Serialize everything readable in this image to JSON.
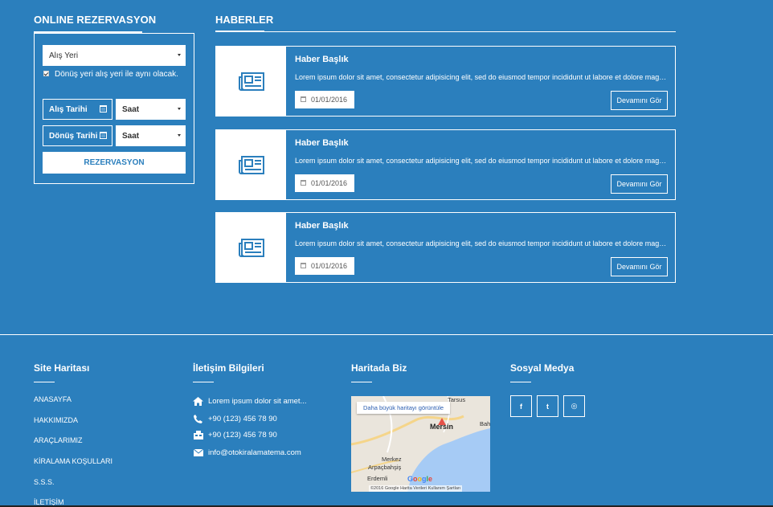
{
  "reservation": {
    "title": "ONLINE REZERVASYON",
    "pickup_placeholder": "Alış Yeri",
    "return_same_label": "Dönüş yeri alış yeri ile aynı olacak.",
    "return_same_checked": true,
    "pickup_date_label": "Alış Tarihi",
    "return_date_label": "Dönüş Tarihi",
    "pickup_time_label": "Saat",
    "return_time_label": "Saat",
    "submit_label": "REZERVASYON"
  },
  "news": {
    "title": "HABERLER",
    "items": [
      {
        "headline": "Haber Başlık",
        "text": "Lorem ipsum dolor sit amet, consectetur adipisicing elit, sed do eiusmod tempor incididunt ut labore et dolore magna aliqua.",
        "date": "01/01/2016",
        "more_label": "Devamını Gör"
      },
      {
        "headline": "Haber Başlık",
        "text": "Lorem ipsum dolor sit amet, consectetur adipisicing elit, sed do eiusmod tempor incididunt ut labore et dolore magna aliqua.",
        "date": "01/01/2016",
        "more_label": "Devamını Gör"
      },
      {
        "headline": "Haber Başlık",
        "text": "Lorem ipsum dolor sit amet, consectetur adipisicing elit, sed do eiusmod tempor incididunt ut labore et dolore magna aliqua.",
        "date": "01/01/2016",
        "more_label": "Devamını Gör"
      }
    ]
  },
  "footer": {
    "sitemap": {
      "title": "Site Haritası",
      "links": [
        "ANASAYFA",
        "HAKKIMIZDA",
        "ARAÇLARIMIZ",
        "KİRALAMA KOŞULLARI",
        "S.S.S.",
        "İLETİŞİM"
      ]
    },
    "contact": {
      "title": "İletişim Bilgileri",
      "address": "Lorem ipsum dolor sit amet...",
      "phone": "+90 (123) 456 78 90",
      "fax": "+90 (123) 456 78 90",
      "email": "info@otokiralamatema.com"
    },
    "map": {
      "title": "Haritada Biz",
      "larger_map_link": "Daha büyük haritayı görüntüle",
      "city": "Mersin",
      "labels": [
        "Merkez",
        "Arpaçbahşiş",
        "Erdemli",
        "Tarsus",
        "Bah"
      ],
      "brand": "Google",
      "attribution": "©2016 Google  Harita Verileri  Kullanım Şartları"
    },
    "social": {
      "title": "Sosyal Medya",
      "icons": [
        "facebook-icon",
        "twitter-icon",
        "instagram-icon"
      ],
      "glyphs": [
        "f",
        "t",
        "◎"
      ]
    }
  },
  "colors": {
    "background": "#2b7fbd",
    "white": "#ffffff"
  }
}
